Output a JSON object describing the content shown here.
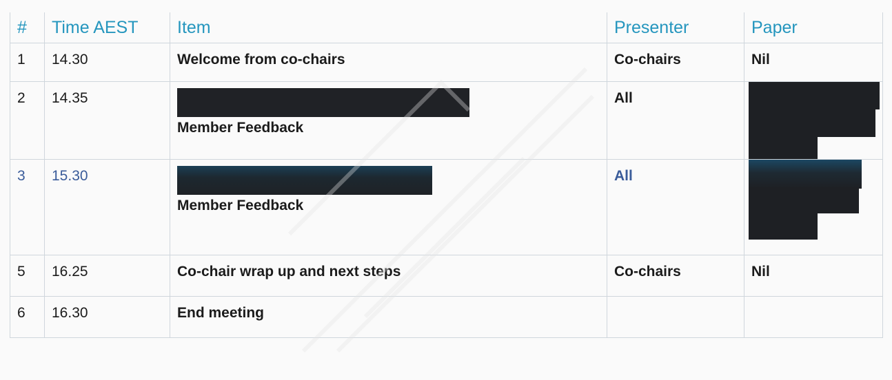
{
  "table": {
    "headers": [
      "#",
      "Time AEST",
      "Item",
      "Presenter",
      "Paper"
    ],
    "rows": [
      {
        "num": "1",
        "time": "14.30",
        "item": "Welcome from co-chairs",
        "presenter": "Co-chairs",
        "paper": "Nil"
      },
      {
        "num": "2",
        "time": "14.35",
        "item": "Member Feedback",
        "presenter": "All",
        "paper": ""
      },
      {
        "num": "3",
        "time": "15.30",
        "item": "Member Feedback",
        "presenter": "All",
        "paper": ""
      },
      {
        "num": "5",
        "time": "16.25",
        "item": "Co-chair wrap up and next steps",
        "presenter": "Co-chairs",
        "paper": "Nil"
      },
      {
        "num": "6",
        "time": "16.30",
        "item": "End meeting",
        "presenter": "",
        "paper": ""
      }
    ]
  },
  "colors": {
    "header_text": "#2596be",
    "grid": "#cfd6dc",
    "redaction": "#202226"
  }
}
